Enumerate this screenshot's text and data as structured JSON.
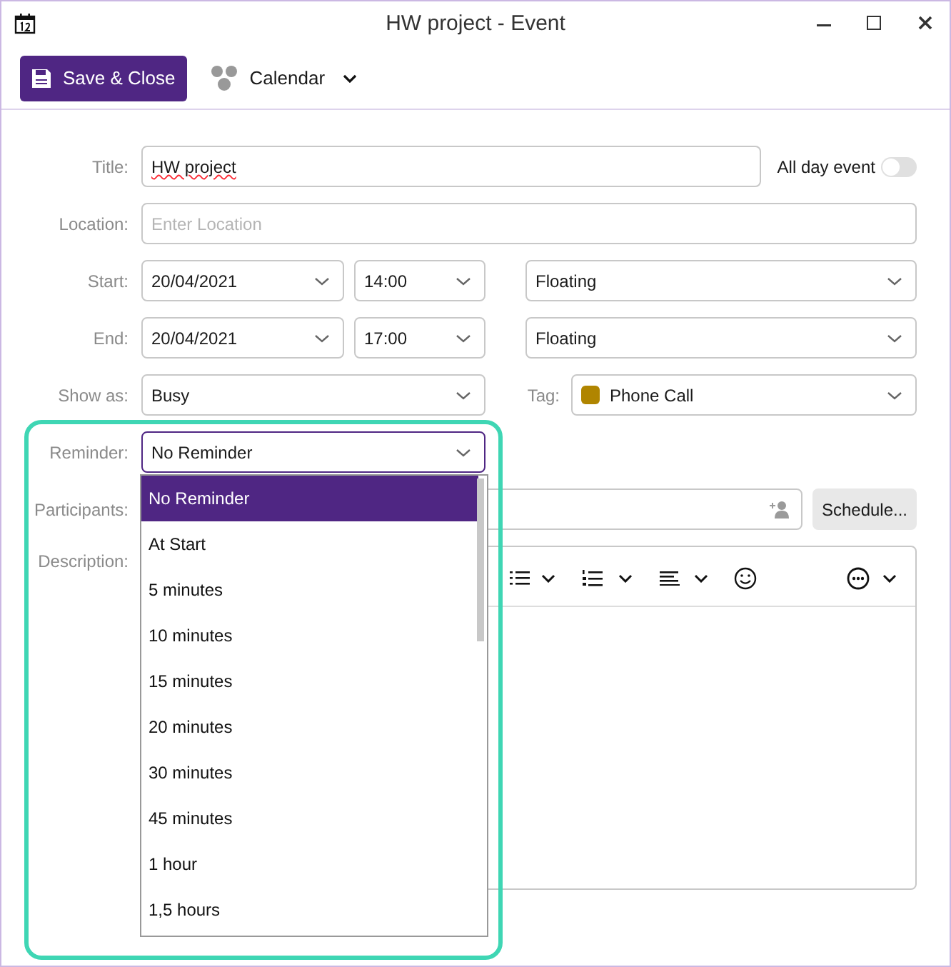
{
  "window": {
    "title": "HW project - Event"
  },
  "toolbar": {
    "save_button": "Save & Close",
    "calendar_button": "Calendar"
  },
  "form": {
    "title": {
      "label": "Title:",
      "value": "HW project"
    },
    "all_day": {
      "label": "All day event",
      "on": false
    },
    "location": {
      "label": "Location:",
      "placeholder": "Enter Location"
    },
    "start": {
      "label": "Start:",
      "date": "20/04/2021",
      "time": "14:00",
      "timezone": "Floating"
    },
    "end": {
      "label": "End:",
      "date": "20/04/2021",
      "time": "17:00",
      "timezone": "Floating"
    },
    "show_as": {
      "label": "Show as:",
      "value": "Busy"
    },
    "tag": {
      "label": "Tag:",
      "value": "Phone Call",
      "color": "#b08500"
    },
    "reminder": {
      "label": "Reminder:",
      "value": "No Reminder",
      "expanded": true
    },
    "participants": {
      "label": "Participants:",
      "schedule_button": "Schedule..."
    },
    "description": {
      "label": "Description:"
    }
  },
  "reminder_options": [
    {
      "label": "No Reminder",
      "selected": true
    },
    {
      "label": "At Start",
      "selected": false
    },
    {
      "label": "5 minutes",
      "selected": false
    },
    {
      "label": "10 minutes",
      "selected": false
    },
    {
      "label": "15 minutes",
      "selected": false
    },
    {
      "label": "20 minutes",
      "selected": false
    },
    {
      "label": "30 minutes",
      "selected": false
    },
    {
      "label": "45 minutes",
      "selected": false
    },
    {
      "label": "1 hour",
      "selected": false
    },
    {
      "label": "1,5 hours",
      "selected": false
    }
  ]
}
